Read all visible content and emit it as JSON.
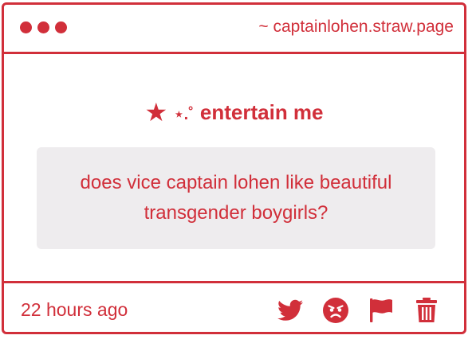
{
  "window": {
    "url_text": "~ captainlohen.straw.page"
  },
  "prompt": {
    "star": "★",
    "sparkle": "⋆.˚",
    "title": "entertain me"
  },
  "question": {
    "text": "does vice captain lohen like beautiful transgender boygirls?"
  },
  "footer": {
    "timestamp": "22 hours ago",
    "icons": [
      "twitter-icon",
      "angry-face-icon",
      "flag-icon",
      "trash-icon"
    ]
  },
  "colors": {
    "accent": "#d12f3a",
    "question_bg": "#eeecee"
  }
}
